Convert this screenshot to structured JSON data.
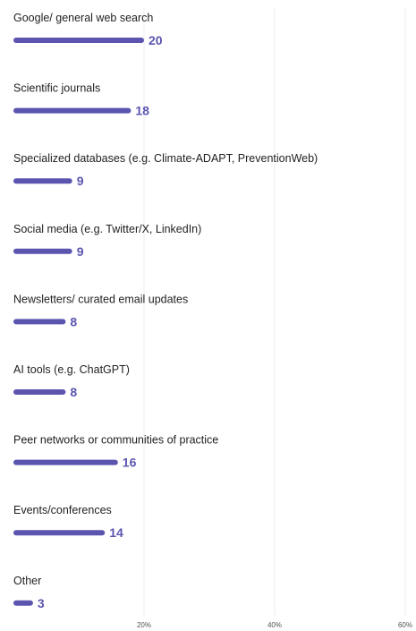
{
  "chart_data": {
    "type": "bar",
    "orientation": "horizontal",
    "categories": [
      "Google/ general web search",
      "Scientific journals",
      "Specialized databases (e.g. Climate-ADAPT, PreventionWeb)",
      "Social media (e.g. Twitter/X, LinkedIn)",
      "Newsletters/ curated email updates",
      "AI tools (e.g. ChatGPT)",
      "Peer networks or communities of practice",
      "Events/conferences",
      "Other"
    ],
    "values": [
      20,
      18,
      9,
      9,
      8,
      8,
      16,
      14,
      3
    ],
    "value_labels": [
      "20",
      "18",
      "9",
      "9",
      "8",
      "8",
      "16",
      "14",
      "3"
    ],
    "x_unit": "percent",
    "xlim": [
      0,
      60
    ],
    "x_ticks": [
      20,
      40,
      60
    ],
    "x_tick_labels": [
      "20%",
      "40%",
      "60%"
    ],
    "grid": "vertical",
    "colors": {
      "bar": "#5b55b0",
      "value_label": "#5b55b0",
      "category_label": "#1f1f1f",
      "grid": "#ececec",
      "tick_label": "#555555"
    }
  }
}
